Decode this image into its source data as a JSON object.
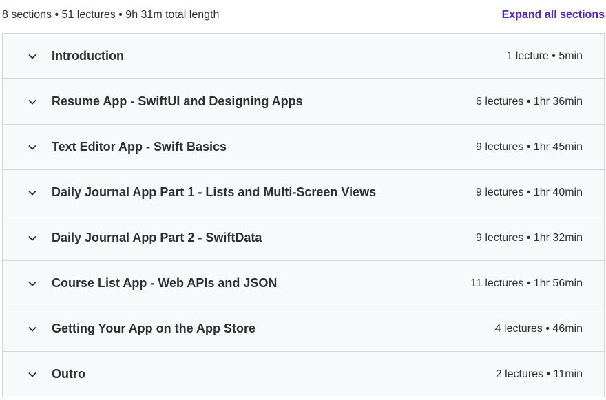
{
  "header": {
    "summary": "8 sections • 51 lectures • 9h 31m total length",
    "expand_label": "Expand all sections"
  },
  "colors": {
    "accent": "#5624d0",
    "row_bg": "#f7f9fa",
    "border": "#d1d7dc",
    "text": "#2d2f31"
  },
  "sections": [
    {
      "title": "Introduction",
      "meta": "1 lecture • 5min",
      "icon": "chevron-down-icon"
    },
    {
      "title": "Resume App - SwiftUI and Designing Apps",
      "meta": "6 lectures • 1hr 36min",
      "icon": "chevron-down-icon"
    },
    {
      "title": "Text Editor App - Swift Basics",
      "meta": "9 lectures • 1hr 45min",
      "icon": "chevron-down-icon"
    },
    {
      "title": "Daily Journal App Part 1 - Lists and Multi-Screen Views",
      "meta": "9 lectures • 1hr 40min",
      "icon": "chevron-down-icon"
    },
    {
      "title": "Daily Journal App Part 2 - SwiftData",
      "meta": "9 lectures • 1hr 32min",
      "icon": "chevron-down-icon"
    },
    {
      "title": "Course List App - Web APIs and JSON",
      "meta": "11 lectures • 1hr 56min",
      "icon": "chevron-down-icon"
    },
    {
      "title": "Getting Your App on the App Store",
      "meta": "4 lectures • 46min",
      "icon": "chevron-down-icon"
    },
    {
      "title": "Outro",
      "meta": "2 lectures • 11min",
      "icon": "chevron-down-icon"
    }
  ]
}
